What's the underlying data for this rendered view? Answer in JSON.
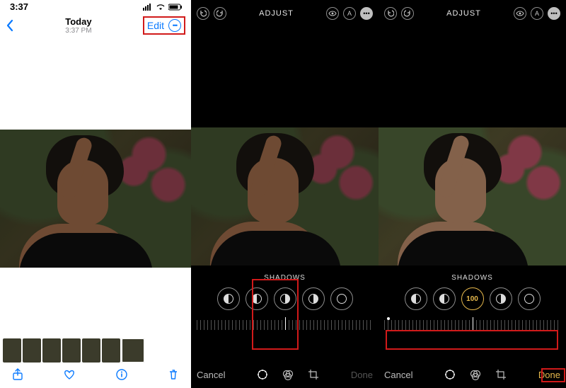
{
  "status": {
    "time": "3:37"
  },
  "photos_header": {
    "title": "Today",
    "subtitle": "3:37 PM",
    "edit": "Edit"
  },
  "toolbar_icons": {
    "share": "share-icon",
    "heart": "heart-icon",
    "info": "info-icon",
    "trash": "trash-icon"
  },
  "edit": {
    "adjust_label": "ADJUST",
    "section_label": "SHADOWS"
  },
  "edit_bottom": {
    "cancel": "Cancel",
    "done": "Done"
  },
  "edit3": {
    "value": "100"
  }
}
